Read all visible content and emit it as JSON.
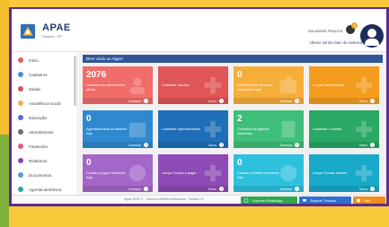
{
  "header": {
    "brand": "APAE",
    "brand_sub": "Paraná - SP",
    "user_name": "ISA APARE PRADOS",
    "notifications_count": "0",
    "links": [
      "Alterar senha",
      "Sair do sistema"
    ]
  },
  "sidebar": {
    "items": [
      {
        "label": "Início",
        "color": "#e85b5b"
      },
      {
        "label": "Cadastros",
        "color": "#4a8ad8"
      },
      {
        "label": "Saúde",
        "color": "#d9534f"
      },
      {
        "label": "Assistência social",
        "color": "#f0ad4e"
      },
      {
        "label": "Educação",
        "color": "#5b6bd8"
      },
      {
        "label": "Atendimentos",
        "color": "#6b6b6b"
      },
      {
        "label": "Financeiro",
        "color": "#e05a8a"
      },
      {
        "label": "Relatórios",
        "color": "#8e44ad"
      },
      {
        "label": "Documentos",
        "color": "#5c9bd6"
      },
      {
        "label": "Agenda eletrônica",
        "color": "#3aa0a0"
      }
    ]
  },
  "main": {
    "welcome": "Bem vindo ao Algaz!",
    "cards": [
      {
        "value": "2076",
        "desc": "Usuários em atendimento ativos",
        "foot": "Acessar",
        "color": "#f06d6a",
        "icon": "users-icon"
      },
      {
        "value": "",
        "desc": "Cadastrar Usuário",
        "foot": "Novo",
        "color": "#e05556",
        "icon": "plus-icon"
      },
      {
        "value": "0",
        "desc": "Atendimentos de saúde registrados hoje",
        "foot": "Acessar",
        "color": "#f6ad3a",
        "icon": "medkit-icon"
      },
      {
        "value": "",
        "desc": "Lançar Atendimentos",
        "foot": "Novo",
        "color": "#f49c1e",
        "icon": "plus-icon"
      },
      {
        "value": "0",
        "desc": "Agendamentos do sistema hoje",
        "foot": "Acessar",
        "color": "#2f89cf",
        "icon": "calendar-icon"
      },
      {
        "value": "",
        "desc": "Cadastrar Agendamentos",
        "foot": "Novo",
        "color": "#1e6fb8",
        "icon": "plus-icon"
      },
      {
        "value": "2",
        "desc": "Contratos da agenda eletrônica",
        "foot": "Acessar",
        "color": "#3fbf7a",
        "icon": "document-icon"
      },
      {
        "value": "",
        "desc": "Cadastrar Contrato",
        "foot": "Novo",
        "color": "#2aa866",
        "icon": "plus-icon"
      },
      {
        "value": "0",
        "desc": "Contas a pagar vencendo hoje",
        "foot": "Acessar",
        "color": "#a467c8",
        "icon": "dollar-icon"
      },
      {
        "value": "",
        "desc": "Lançar Contas a pagar",
        "foot": "Novo",
        "color": "#8e4bb5",
        "icon": "plus-icon"
      },
      {
        "value": "0",
        "desc": "Contas a receber vencendo hoje",
        "foot": "Acessar",
        "color": "#2fc0dd",
        "icon": "dollar-icon"
      },
      {
        "value": "",
        "desc": "Lançar Contas receber",
        "foot": "Novo",
        "color": "#19a9c9",
        "icon": "plus-icon"
      }
    ]
  },
  "footer": {
    "text": "Algaz 2024 © - Todos os direitos reservados - Versão 1.0",
    "whatsapp": "Suporte WhatsApp",
    "support": "Suporte Técnico",
    "exit": "Sair"
  }
}
